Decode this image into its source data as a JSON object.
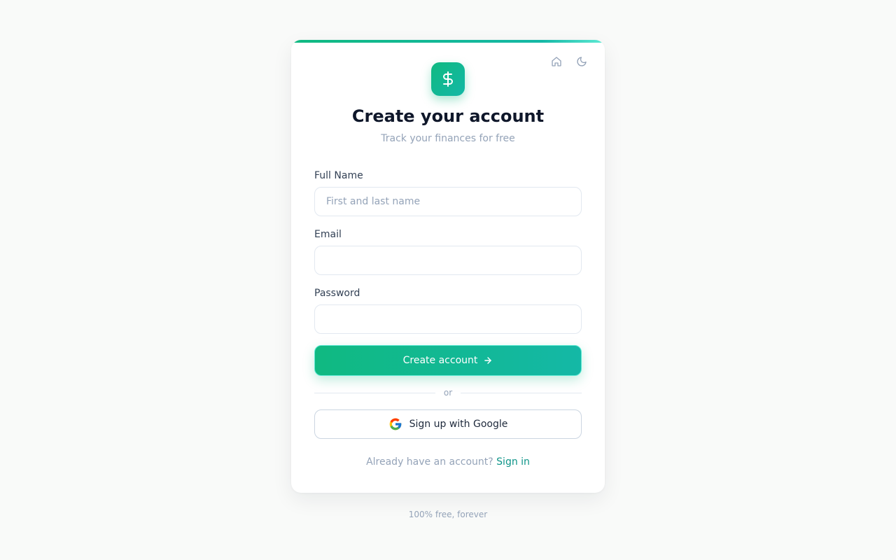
{
  "header": {
    "title": "Create your account",
    "subtitle": "Track your finances for free",
    "logo_symbol": "$",
    "logo_icon": "dollar-icon",
    "home_icon": "home-icon",
    "theme_icon": "moon-icon"
  },
  "form": {
    "full_name": {
      "label": "Full Name",
      "placeholder": "First and last name",
      "value": ""
    },
    "email": {
      "label": "Email",
      "placeholder": "",
      "value": ""
    },
    "password": {
      "label": "Password",
      "placeholder": "",
      "value": ""
    },
    "submit_label": "Create account",
    "submit_icon": "arrow-right-icon"
  },
  "divider_text": "or",
  "google_button": {
    "label": "Sign up with Google",
    "icon": "google-icon"
  },
  "signin": {
    "prompt": "Already have an account?",
    "link_label": "Sign in"
  },
  "footer_note": "100% free, forever",
  "colors": {
    "accent": "#10b981",
    "accent_secondary": "#14b8a6",
    "link": "#0d9488",
    "background": "#f9faf9"
  }
}
